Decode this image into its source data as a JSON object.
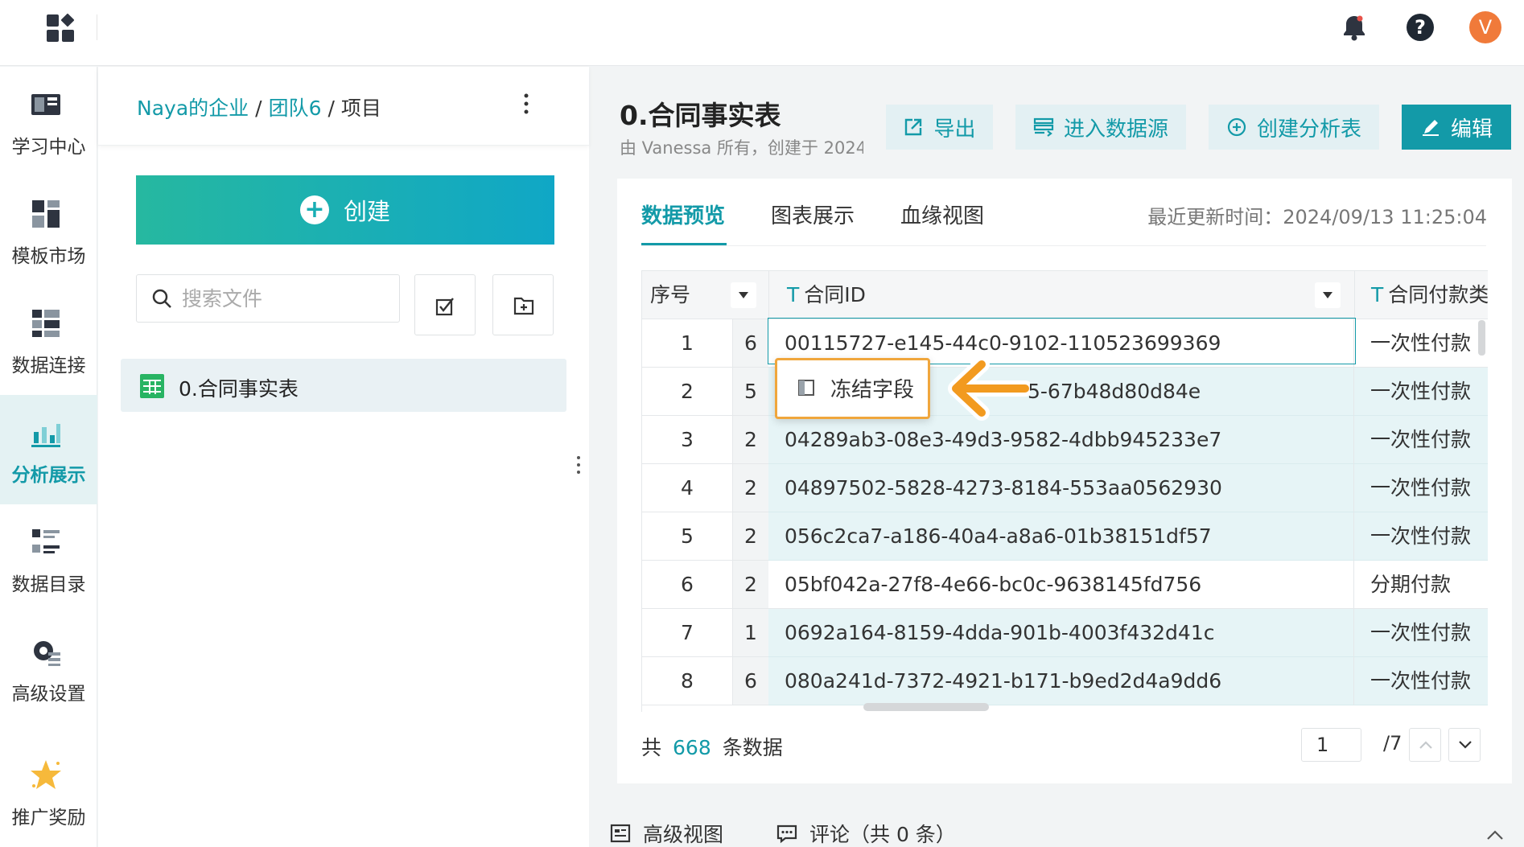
{
  "breadcrumb": {
    "org": "Naya的企业",
    "team": "团队6",
    "sep1": "/",
    "sep2": "/",
    "current": "项目"
  },
  "left_nav": {
    "items": [
      {
        "label": "学习中心",
        "icon": "book-icon"
      },
      {
        "label": "模板市场",
        "icon": "template-icon"
      },
      {
        "label": "数据连接",
        "icon": "data-connect-icon"
      },
      {
        "label": "分析展示",
        "icon": "chart-icon",
        "active": true
      },
      {
        "label": "数据目录",
        "icon": "catalog-icon"
      },
      {
        "label": "高级设置",
        "icon": "settings-icon"
      },
      {
        "label": "推广奖励",
        "icon": "star-icon"
      }
    ]
  },
  "sidebar": {
    "create_label": "创建",
    "search_placeholder": "搜索文件",
    "file_name": "0.合同事实表"
  },
  "user": {
    "avatar_initial": "V"
  },
  "main": {
    "title": "0.合同事实表",
    "subtitle": "由 Vanessa 所有，创建于 2024",
    "actions": {
      "export": "导出",
      "enter_source": "进入数据源",
      "create_analysis": "创建分析表",
      "edit": "编辑"
    },
    "tabs": [
      "数据预览",
      "图表展示",
      "血缘视图"
    ],
    "updated_label": "最近更新时间：",
    "updated_time": "2024/09/13 11:25:04"
  },
  "table": {
    "headers": {
      "index": "序号",
      "contract_id": "合同ID",
      "payment": "合同付款类型",
      "text_type_marker": "T"
    },
    "rows": [
      {
        "idx": "1",
        "n": "6",
        "id": "00115727-e145-44c0-9102-110523699369",
        "pay": "一次性付款"
      },
      {
        "idx": "2",
        "n": "5",
        "id": "5-67b48d80d84e",
        "pay": "一次性付款"
      },
      {
        "idx": "3",
        "n": "2",
        "id": "04289ab3-08e3-49d3-9582-4dbb945233e7",
        "pay": "一次性付款"
      },
      {
        "idx": "4",
        "n": "2",
        "id": "04897502-5828-4273-8184-553aa0562930",
        "pay": "一次性付款"
      },
      {
        "idx": "5",
        "n": "2",
        "id": "056c2ca7-a186-40a4-a8a6-01b38151df57",
        "pay": "一次性付款"
      },
      {
        "idx": "6",
        "n": "2",
        "id": "05bf042a-27f8-4e66-bc0c-9638145fd756",
        "pay": "分期付款"
      },
      {
        "idx": "7",
        "n": "1",
        "id": "0692a164-8159-4dda-901b-4003f432d41c",
        "pay": "一次性付款"
      },
      {
        "idx": "8",
        "n": "6",
        "id": "080a241d-7372-4921-b171-b9ed2d4a9dd6",
        "pay": "一次性付款"
      }
    ]
  },
  "context_menu": {
    "freeze_field": "冻结字段"
  },
  "footer": {
    "count_prefix": "共",
    "count": "668",
    "count_suffix": "条数据",
    "page": "1",
    "total_pages": "/7"
  },
  "bottom": {
    "advanced_view": "高级视图",
    "comments": "评论（共 0 条）"
  },
  "colors": {
    "accent": "#139aa8",
    "highlight": "#f0a63c",
    "avatar": "#f07a3a"
  }
}
